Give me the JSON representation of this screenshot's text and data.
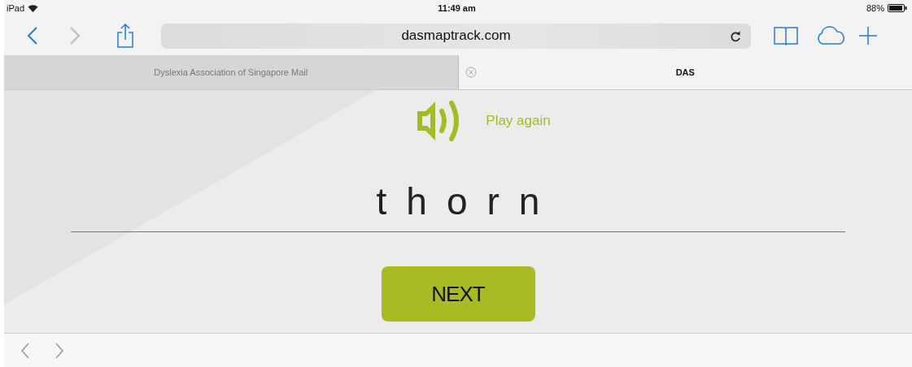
{
  "status_bar": {
    "device": "iPad",
    "time": "11:49 am",
    "battery": "88%"
  },
  "toolbar": {
    "url": "dasmaptrack.com"
  },
  "tabs": [
    {
      "label": "Dyslexia Association of Singapore Mail",
      "selected": false
    },
    {
      "label": "DAS",
      "selected": true
    }
  ],
  "page": {
    "play_label": "Play again",
    "word": "thorn",
    "next_button": "NEXT"
  }
}
